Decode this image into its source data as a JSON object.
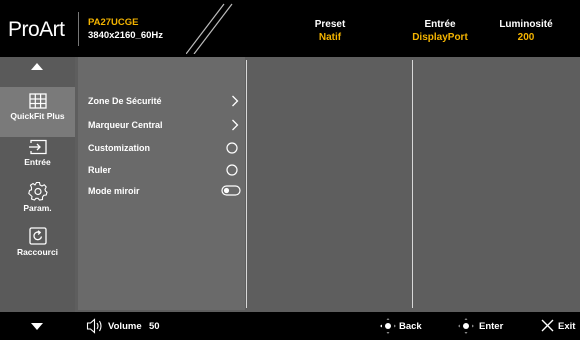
{
  "header": {
    "brand": "ProArt",
    "model": "PA27UCGE",
    "resolution": "3840x2160_60Hz",
    "preset_label": "Preset",
    "preset_value": "Natif",
    "input_label": "Entrée",
    "input_value": "DisplayPort",
    "brightness_label": "Luminosité",
    "brightness_value": "200"
  },
  "sidebar": {
    "items": [
      {
        "label": "QuickFit Plus",
        "icon": "grid-icon"
      },
      {
        "label": "Entrée",
        "icon": "input-icon"
      },
      {
        "label": "Param.",
        "icon": "gear-icon"
      },
      {
        "label": "Raccourci",
        "icon": "shortcut-icon"
      }
    ]
  },
  "menu": {
    "items": [
      {
        "label": "Zone De Sécurité",
        "control": "chevron"
      },
      {
        "label": "Marqueur Central",
        "control": "chevron"
      },
      {
        "label": "Customization",
        "control": "radio"
      },
      {
        "label": "Ruler",
        "control": "radio"
      },
      {
        "label": "Mode miroir",
        "control": "toggle"
      }
    ]
  },
  "footer": {
    "volume_label": "Volume",
    "volume_value": "50",
    "back_label": "Back",
    "enter_label": "Enter",
    "exit_label": "Exit"
  },
  "colors": {
    "accent": "#f4b400",
    "background": "#5e5e5e",
    "bar": "#000000"
  }
}
